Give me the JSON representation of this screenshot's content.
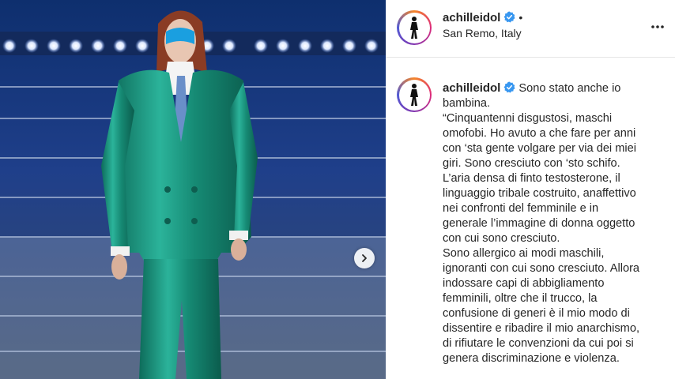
{
  "post": {
    "username": "achilleidol",
    "location": "San Remo, Italy",
    "header_dot": "•",
    "caption": "Sono stato anche io\nbambina.\n“Cinquantenni disgustosi, maschi\nomofobi. Ho avuto a che fare per anni\ncon ‘sta gente volgare per via dei miei\ngiri. Sono cresciuto con ‘sto schifo.\nL’aria densa di finto testosterone, il\nlinguaggio tribale costruito, anaffettivo\nnei confronti del femminile e in\ngenerale l’immagine di donna oggetto\ncon cui sono cresciuto.\nSono allergico ai modi maschili,\nignoranti con cui sono cresciuto. Allora\nindossare capi di abbigliamento\nfemminili, oltre che il trucco, la\nconfusione di generi è il mio modo di\ndissentire e ribadire il mio anarchismo,\ndi rifiutare le convenzioni da cui poi si\ngenera discriminazione e violenza."
  },
  "icons": {
    "verified": "verified-badge-icon",
    "more": "more-options-icon",
    "next": "chevron-right-icon"
  },
  "colors": {
    "verified_blue": "#3897f0",
    "suit": "#1f8f7a",
    "text": "#262626"
  }
}
